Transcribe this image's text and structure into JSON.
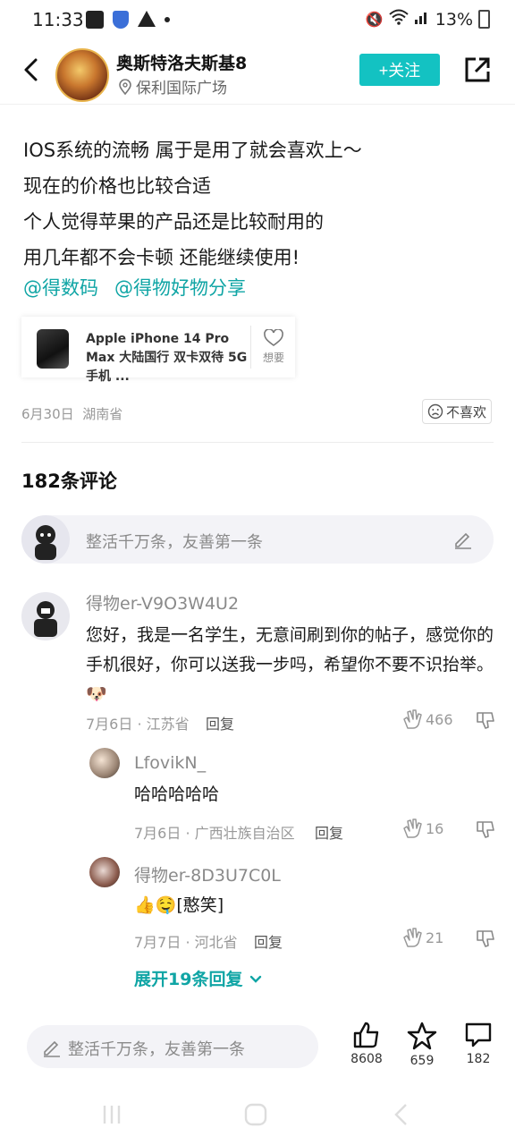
{
  "status": {
    "time": "11:33",
    "battery": "13%"
  },
  "header": {
    "user_name": "奥斯特洛夫斯基8",
    "location": "保利国际广场",
    "follow_label": "+关注"
  },
  "post": {
    "lines": [
      "IOS系统的流畅 属于是用了就会喜欢上～",
      "现在的价格也比较合适",
      "个人觉得苹果的产品还是比较耐用的",
      "用几年都不会卡顿 还能继续使用!"
    ],
    "mentions": [
      "@得数码",
      "@得物好物分享"
    ],
    "product": {
      "title": "Apple iPhone 14 Pro Max 大陆国行 双卡双待 5G 手机 ...",
      "want_label": "想要"
    },
    "date": "6月30日",
    "region": "湖南省",
    "dislike_label": "不喜欢"
  },
  "comments_section": {
    "count_label": "182条评论",
    "input_placeholder": "整活千万条，友善第一条"
  },
  "comments": [
    {
      "name": "得物er-V9O3W4U2",
      "text": "您好，我是一名学生，无意间刷到你的帖子，感觉你的手机很好，你可以送我一步吗，希望你不要不识抬举。🐶",
      "meta": "7月6日 · 江苏省",
      "reply_label": "回复",
      "likes": "466"
    },
    {
      "name": "LfovikN_",
      "text": "哈哈哈哈哈",
      "meta": "7月6日 · 广西壮族自治区",
      "reply_label": "回复",
      "likes": "16"
    },
    {
      "name": "得物er-8D3U7C0L",
      "text": "👍🤤[憨笑]",
      "meta": "7月7日 · 河北省",
      "reply_label": "回复",
      "likes": "21"
    }
  ],
  "expand_label": "展开19条回复",
  "bottom_bar": {
    "input_placeholder": "整活千万条，友善第一条",
    "like_count": "8608",
    "fav_count": "659",
    "comment_count": "182"
  },
  "colors": {
    "accent": "#13c2c2",
    "link": "#10a5a5"
  }
}
